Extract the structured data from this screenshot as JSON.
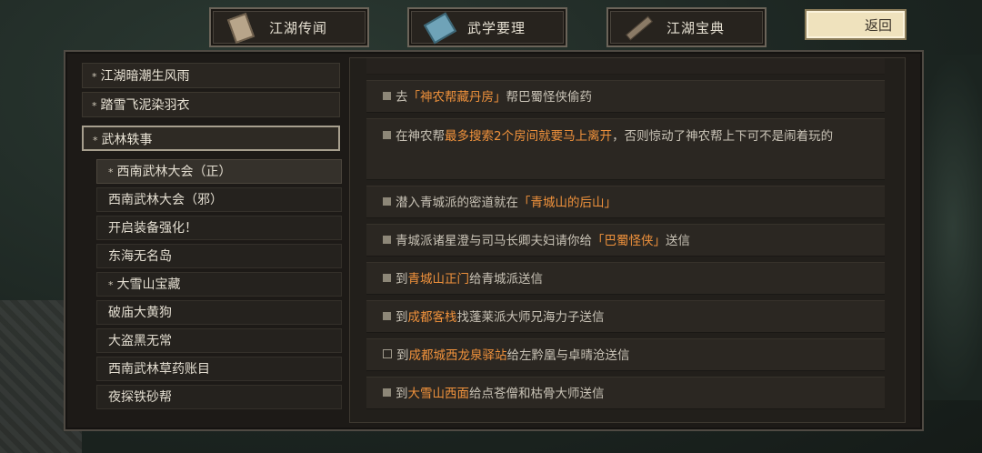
{
  "tabs": [
    {
      "label": "江湖传闻",
      "icon": "scroll-icon"
    },
    {
      "label": "武学要理",
      "icon": "book-icon"
    },
    {
      "label": "江湖宝典",
      "icon": "sword-icon"
    }
  ],
  "back_label": "返回",
  "categories": [
    {
      "label": "江湖暗潮生风雨",
      "starred": true
    },
    {
      "label": "踏雪飞泥染羽衣",
      "starred": true
    },
    {
      "label": "武林轶事",
      "starred": true,
      "selected": true
    }
  ],
  "subitems": [
    {
      "label": "西南武林大会（正）",
      "starred": true,
      "selected": true
    },
    {
      "label": "西南武林大会（邪）"
    },
    {
      "label": "开启装备强化！"
    },
    {
      "label": "东海无名岛"
    },
    {
      "label": "大雪山宝藏",
      "starred": true
    },
    {
      "label": "破庙大黄狗"
    },
    {
      "label": "大盗黑无常"
    },
    {
      "label": "西南武林草药账目"
    },
    {
      "label": "夜探铁砂帮"
    }
  ],
  "star_glyph": "*",
  "entries": [
    {
      "parts": [
        [
          "p",
          "去"
        ],
        [
          "h",
          "「神农帮藏丹房」"
        ],
        [
          "p",
          "帮巴蜀怪侠偷药"
        ]
      ],
      "checked": true
    },
    {
      "parts": [
        [
          "p",
          "在神农帮"
        ],
        [
          "h",
          "最多搜索2个房间就要马上离开"
        ],
        [
          "p",
          "，否则惊动了神农帮上下可不是闹着玩的"
        ]
      ],
      "checked": true
    },
    {
      "parts": [
        [
          "p",
          "潜入青城派的密道就在"
        ],
        [
          "h",
          "「青城山的后山」"
        ]
      ],
      "checked": true
    },
    {
      "parts": [
        [
          "p",
          "青城派诸星澄与司马长卿夫妇请你给"
        ],
        [
          "h",
          "「巴蜀怪侠」"
        ],
        [
          "p",
          "送信"
        ]
      ],
      "checked": true
    },
    {
      "parts": [
        [
          "p",
          "到"
        ],
        [
          "h",
          "青城山正门"
        ],
        [
          "p",
          "给青城派送信"
        ]
      ],
      "checked": true
    },
    {
      "parts": [
        [
          "p",
          "到"
        ],
        [
          "h",
          "成都客栈"
        ],
        [
          "p",
          "找蓬莱派大师兄海力子送信"
        ]
      ],
      "checked": true
    },
    {
      "parts": [
        [
          "p",
          "到"
        ],
        [
          "h",
          "成都城西龙泉驿站"
        ],
        [
          "p",
          "给左黔凰与卓晴沧送信"
        ]
      ],
      "checked": false
    },
    {
      "parts": [
        [
          "p",
          "到"
        ],
        [
          "h",
          "大雪山西面"
        ],
        [
          "p",
          "给点苍僧和枯骨大师送信"
        ]
      ],
      "checked": true
    }
  ]
}
